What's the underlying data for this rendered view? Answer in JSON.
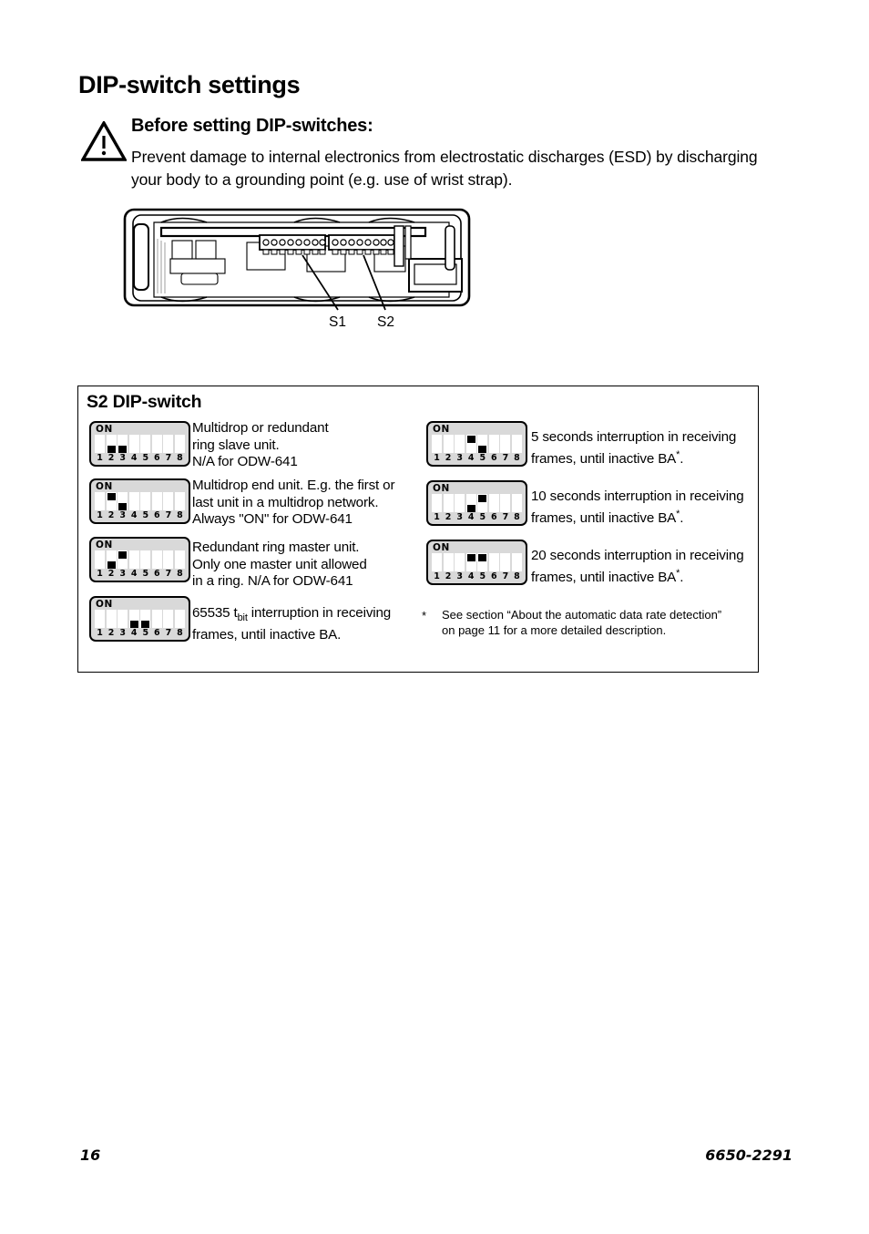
{
  "page": {
    "title": "DIP-switch settings",
    "footer_page_number": "16",
    "footer_doc_number": "6650-2291"
  },
  "warning": {
    "icon": "warning-triangle-icon",
    "heading": "Before setting DIP-switches:",
    "line1": "Prevent damage to internal electronics from electrostatic discharges (ESD)",
    "line2": "by discharging your body to a grounding point (e.g. use of wrist strap)."
  },
  "device_figure": {
    "label_s1": "S1",
    "label_s2": "S2"
  },
  "panel": {
    "title": "S2 DIP-switch",
    "switch_count": 8,
    "numbers": [
      "1",
      "2",
      "3",
      "4",
      "5",
      "6",
      "7",
      "8"
    ],
    "on_label": "ON",
    "left_entries": [
      {
        "switches": [
          {
            "n": "1",
            "pos": "none"
          },
          {
            "n": "2",
            "pos": "down"
          },
          {
            "n": "3",
            "pos": "down"
          },
          {
            "n": "4",
            "pos": "none"
          },
          {
            "n": "5",
            "pos": "none"
          },
          {
            "n": "6",
            "pos": "none"
          },
          {
            "n": "7",
            "pos": "none"
          },
          {
            "n": "8",
            "pos": "none"
          }
        ],
        "lines": [
          "Multidrop or redundant",
          "ring slave unit.",
          "N/A for ODW-641"
        ]
      },
      {
        "switches": [
          {
            "n": "1",
            "pos": "none"
          },
          {
            "n": "2",
            "pos": "up"
          },
          {
            "n": "3",
            "pos": "down"
          },
          {
            "n": "4",
            "pos": "none"
          },
          {
            "n": "5",
            "pos": "none"
          },
          {
            "n": "6",
            "pos": "none"
          },
          {
            "n": "7",
            "pos": "none"
          },
          {
            "n": "8",
            "pos": "none"
          }
        ],
        "lines": [
          "Multidrop end unit. E.g. the first or",
          "last unit in a multidrop network.",
          "Always \"ON\" for ODW-641"
        ]
      },
      {
        "switches": [
          {
            "n": "1",
            "pos": "none"
          },
          {
            "n": "2",
            "pos": "down"
          },
          {
            "n": "3",
            "pos": "up"
          },
          {
            "n": "4",
            "pos": "none"
          },
          {
            "n": "5",
            "pos": "none"
          },
          {
            "n": "6",
            "pos": "none"
          },
          {
            "n": "7",
            "pos": "none"
          },
          {
            "n": "8",
            "pos": "none"
          }
        ],
        "lines": [
          "Redundant ring master unit.",
          "Only one master unit allowed",
          "in a ring. N/A for ODW-641"
        ]
      },
      {
        "switches": [
          {
            "n": "1",
            "pos": "none"
          },
          {
            "n": "2",
            "pos": "none"
          },
          {
            "n": "3",
            "pos": "none"
          },
          {
            "n": "4",
            "pos": "down"
          },
          {
            "n": "5",
            "pos": "down"
          },
          {
            "n": "6",
            "pos": "none"
          },
          {
            "n": "7",
            "pos": "none"
          },
          {
            "n": "8",
            "pos": "none"
          }
        ],
        "text_prefix": "65535 t",
        "text_sub": "bit",
        "text_rest": " interruption in receiving",
        "line2": "frames, until inactive BA."
      }
    ],
    "right_entries": [
      {
        "switches": [
          {
            "n": "1",
            "pos": "none"
          },
          {
            "n": "2",
            "pos": "none"
          },
          {
            "n": "3",
            "pos": "none"
          },
          {
            "n": "4",
            "pos": "up"
          },
          {
            "n": "5",
            "pos": "down"
          },
          {
            "n": "6",
            "pos": "none"
          },
          {
            "n": "7",
            "pos": "none"
          },
          {
            "n": "8",
            "pos": "none"
          }
        ],
        "line1": "5 seconds interruption in receiving",
        "line2_prefix": "frames, until inactive BA",
        "line2_sup": "*",
        "line2_suffix": "."
      },
      {
        "switches": [
          {
            "n": "1",
            "pos": "none"
          },
          {
            "n": "2",
            "pos": "none"
          },
          {
            "n": "3",
            "pos": "none"
          },
          {
            "n": "4",
            "pos": "down"
          },
          {
            "n": "5",
            "pos": "up"
          },
          {
            "n": "6",
            "pos": "none"
          },
          {
            "n": "7",
            "pos": "none"
          },
          {
            "n": "8",
            "pos": "none"
          }
        ],
        "line1": "10 seconds interruption in receiving",
        "line2_prefix": "frames, until inactive BA",
        "line2_sup": "*",
        "line2_suffix": "."
      },
      {
        "switches": [
          {
            "n": "1",
            "pos": "none"
          },
          {
            "n": "2",
            "pos": "none"
          },
          {
            "n": "3",
            "pos": "none"
          },
          {
            "n": "4",
            "pos": "up"
          },
          {
            "n": "5",
            "pos": "up"
          },
          {
            "n": "6",
            "pos": "none"
          },
          {
            "n": "7",
            "pos": "none"
          },
          {
            "n": "8",
            "pos": "none"
          }
        ],
        "line1": "20 seconds interruption in receiving",
        "line2_prefix": "frames, until inactive BA",
        "line2_sup": "*",
        "line2_suffix": "."
      }
    ],
    "footnote": {
      "marker": "*",
      "line1": "See section “About the automatic data rate detection”",
      "line2": "on page 11 for a more detailed description."
    }
  }
}
